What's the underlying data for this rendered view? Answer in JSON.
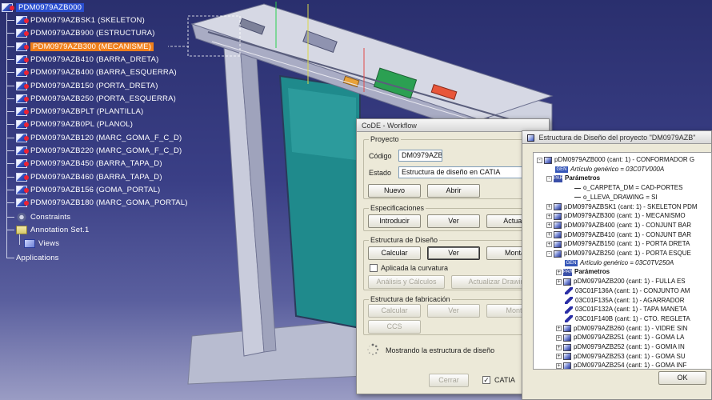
{
  "tree": {
    "root": "PDM0979AZB000",
    "items": [
      {
        "label": "PDM0979AZBSK1 (SKELETON)"
      },
      {
        "label": "PDM0979AZB900 (ESTRUCTURA)"
      },
      {
        "label": "PDM0979AZB300 (MECANISME)",
        "selected": true
      },
      {
        "label": "PDM0979AZB410 (BARRA_DRETA)"
      },
      {
        "label": "PDM0979AZB400 (BARRA_ESQUERRA)"
      },
      {
        "label": "PDM0979AZB150 (PORTA_DRETA)"
      },
      {
        "label": "PDM0979AZB250 (PORTA_ESQUERRA)"
      },
      {
        "label": "PDM0979AZBPLT (PLANTILLA)"
      },
      {
        "label": "PDM0979AZB0PL (PLANOL)"
      },
      {
        "label": "PDM0979AZB120 (MARC_GOMA_F_C_D)"
      },
      {
        "label": "PDM0979AZB220 (MARC_GOMA_F_C_D)"
      },
      {
        "label": "PDM0979AZB450 (BARRA_TAPA_D)"
      },
      {
        "label": "PDM0979AZB460 (BARRA_TAPA_D)"
      },
      {
        "label": "PDM0979AZB156 (GOMA_PORTAL)"
      },
      {
        "label": "PDM0979AZB180 (MARC_GOMA_PORTAL)"
      }
    ],
    "constraints": "Constraints",
    "annotation_set": "Annotation Set.1",
    "views": "Views",
    "applications": "Applications"
  },
  "workflow": {
    "title": "CoDE - Workflow",
    "proyecto": {
      "legend": "Proyecto",
      "codigo_label": "Código",
      "codigo_value": "DM0979AZB",
      "estado_label": "Estado",
      "estado_value": "Estructura de diseño en CATIA",
      "nuevo": "Nuevo",
      "abrir": "Abrir"
    },
    "especificaciones": {
      "legend": "Especificaciones",
      "introducir": "Introducir",
      "ver": "Ver",
      "actualizar": "Actualiz"
    },
    "estructura_diseno": {
      "legend": "Estructura de Diseño",
      "calcular": "Calcular",
      "ver": "Ver",
      "montar": "Montar",
      "aplicada_curvatura": "Aplicada la curvatura",
      "analisis": "Análisis y Cálculos",
      "actualizar_drawings": "Actualizar Drawing"
    },
    "estructura_fabricacion": {
      "legend": "Estructura de fabricación",
      "calcular": "Calcular",
      "ver": "Ver",
      "montar": "Monta",
      "ccs": "CCS"
    },
    "status": "Mostrando la estructura de diseño",
    "cerrar": "Cerrar",
    "catia_label": "CATIA",
    "catia_checked": true
  },
  "structure": {
    "title": "Estructura de Diseño del proyecto \"DM0979AZB\"",
    "ok": "OK",
    "rows": [
      {
        "indent": 0,
        "icon": "part",
        "text": "pDM0979AZB000 (cant: 1) - CONFORMADOR G",
        "exp": "-"
      },
      {
        "indent": 1,
        "icon": "gen",
        "icon_text": "GEN",
        "text": "Artículo genérico = 03C0TV000A",
        "italic": true
      },
      {
        "indent": 1,
        "icon": "par",
        "icon_text": "PAR",
        "text": "Parámetros",
        "bold": true,
        "exp": "-"
      },
      {
        "indent": 3,
        "icon": "dash",
        "text": "o_CARPETA_DM = CAD-PORTES"
      },
      {
        "indent": 3,
        "icon": "dash",
        "text": "o_LLEVA_DRAWING = SI"
      },
      {
        "indent": 1,
        "icon": "part",
        "text": "pDM0979AZBSK1 (cant: 1) - SKELETON PDM",
        "exp": "+"
      },
      {
        "indent": 1,
        "icon": "part",
        "text": "pDM0979AZB300 (cant: 1) - MECANISMO",
        "exp": "+"
      },
      {
        "indent": 1,
        "icon": "part",
        "text": "pDM0979AZB400 (cant: 1) - CONJUNT BAR",
        "exp": "+"
      },
      {
        "indent": 1,
        "icon": "part",
        "text": "pDM0979AZB410 (cant: 1) - CONJUNT BAR",
        "exp": "+"
      },
      {
        "indent": 1,
        "icon": "part",
        "text": "pDM0979AZB150 (cant: 1) - PORTA DRETA",
        "exp": "+"
      },
      {
        "indent": 1,
        "icon": "part",
        "text": "pDM0979AZB250 (cant: 1) - PORTA ESQUE",
        "exp": "-"
      },
      {
        "indent": 2,
        "icon": "gen",
        "icon_text": "GEN",
        "text": "Artículo genérico = 03C0TV250A",
        "italic": true
      },
      {
        "indent": 2,
        "icon": "par",
        "icon_text": "PAR",
        "text": "Parámetros",
        "bold": true,
        "exp": "+"
      },
      {
        "indent": 2,
        "icon": "part",
        "text": "pDM0979AZB200 (cant: 1) - FULLA ES",
        "exp": "+"
      },
      {
        "indent": 2,
        "icon": "pen",
        "text": "03C01F136A (cant: 1) - CONJUNTO AM"
      },
      {
        "indent": 2,
        "icon": "pen",
        "text": "03C01F135A (cant: 1) - AGARRADOR"
      },
      {
        "indent": 2,
        "icon": "pen",
        "text": "03C01F132A (cant: 1) - TAPA MANETA"
      },
      {
        "indent": 2,
        "icon": "pen",
        "text": "03C01F140B (cant: 1) - CTO. REGLETA"
      },
      {
        "indent": 2,
        "icon": "part",
        "text": "pDM0979AZB260 (cant: 1) - VIDRE SIN",
        "exp": "+"
      },
      {
        "indent": 2,
        "icon": "part",
        "text": "pDM0979AZB251 (cant: 1) - GOMA LA",
        "exp": "+"
      },
      {
        "indent": 2,
        "icon": "part",
        "text": "pDM0979AZB252 (cant: 1) - GOMIA IN",
        "exp": "+"
      },
      {
        "indent": 2,
        "icon": "part",
        "text": "pDM0979AZB253 (cant: 1) - GOMA SU",
        "exp": "+"
      },
      {
        "indent": 2,
        "icon": "part",
        "text": "pDM0979AZB254 (cant: 1) - GOMA INF",
        "exp": "+"
      }
    ]
  },
  "colors": {
    "selection": "#f07f1a",
    "viewport_bg": "#2f3478",
    "dialog_bg": "#ece9d8"
  }
}
